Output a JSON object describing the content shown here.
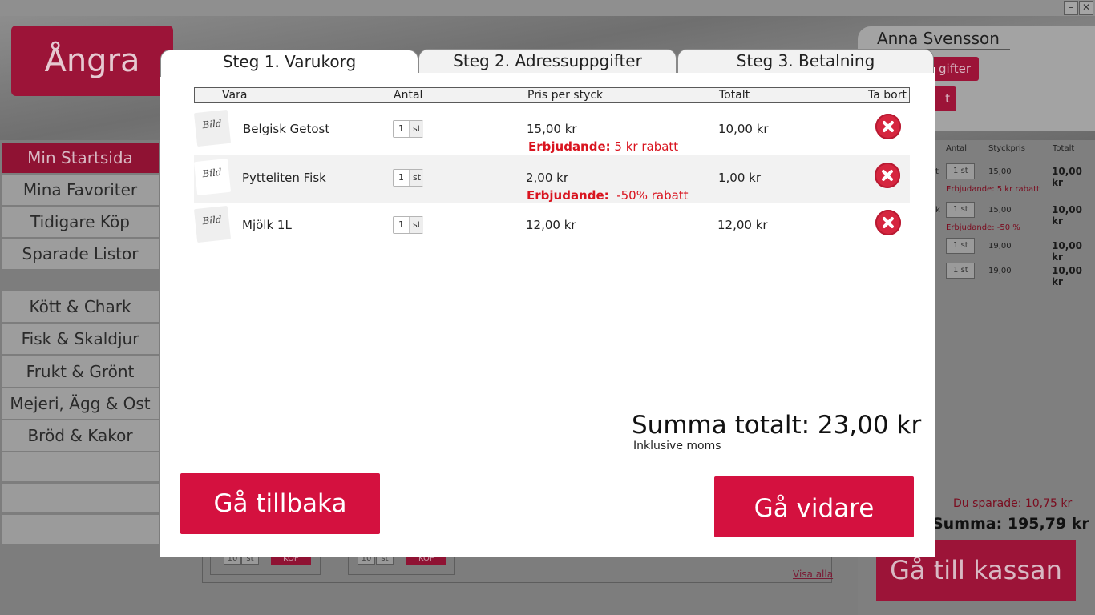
{
  "app": {
    "undo_label": "Ångra",
    "window_controls": {
      "minimize": "–",
      "close": "✕"
    }
  },
  "user": {
    "name": "Anna Svensson",
    "btn1_partial": "gifter",
    "btn2_partial": "t"
  },
  "sidebar": {
    "items": [
      {
        "label": "Min Startsida",
        "active": true
      },
      {
        "label": "Mina Favoriter"
      },
      {
        "label": "Tidigare Köp"
      },
      {
        "label": "Sparade Listor"
      }
    ],
    "categories": [
      {
        "label": "Kött & Chark"
      },
      {
        "label": "Fisk & Skaldjur"
      },
      {
        "label": "Frukt & Grönt"
      },
      {
        "label": "Mejeri, Ägg & Ost"
      },
      {
        "label": "Bröd & Kakor"
      }
    ]
  },
  "background": {
    "card_qty": "10",
    "card_unit": "st",
    "card_buy": "KÖP",
    "visa_alla": "Visa alla"
  },
  "cart_pane": {
    "headers": {
      "antal": "Antal",
      "styckpris": "Styckpris",
      "totalt": "Totalt"
    },
    "rows": [
      {
        "name_partial": "t",
        "qty": "1",
        "unit": "st",
        "price": "15,00",
        "total": "10,00 kr",
        "offer": "Erbjudande: 5 kr rabatt"
      },
      {
        "name_partial": "k",
        "qty": "1",
        "unit": "st",
        "price": "15,00",
        "total": "10,00 kr",
        "offer": "Erbjudande: -50 %"
      },
      {
        "name_partial": "",
        "qty": "1",
        "unit": "st",
        "price": "19,00",
        "total": "10,00 kr",
        "offer": ""
      },
      {
        "name_partial": "",
        "qty": "1",
        "unit": "st",
        "price": "19,00",
        "total": "10,00 kr",
        "offer": ""
      }
    ],
    "saved": "Du sparade: 10,75 kr",
    "sum": "Summa: 195,79 kr",
    "checkout": "Gå till kassan"
  },
  "modal": {
    "tabs": [
      {
        "label": "Steg 1. Varukorg",
        "active": true
      },
      {
        "label": "Steg 2. Adressuppgifter"
      },
      {
        "label": "Steg 3. Betalning"
      }
    ],
    "columns": {
      "vara": "Vara",
      "antal": "Antal",
      "pris": "Pris per styck",
      "totalt": "Totalt",
      "ta_bort": "Ta bort"
    },
    "items": [
      {
        "image_label": "Bild",
        "name": "Belgisk Getost",
        "qty": "1",
        "unit": "st",
        "price": "15,00 kr",
        "total": "10,00 kr",
        "offer_label": "Erbjudande:",
        "offer_value": " 5 kr rabatt"
      },
      {
        "image_label": "Bild",
        "name": "Pytteliten Fisk",
        "qty": "1",
        "unit": "st",
        "price": "2,00 kr",
        "total": "1,00 kr",
        "offer_label": "Erbjudande:",
        "offer_value": "  -50% rabatt"
      },
      {
        "image_label": "Bild",
        "name": "Mjölk 1L",
        "qty": "1",
        "unit": "st",
        "price": "12,00 kr",
        "total": "12,00 kr",
        "offer_label": "",
        "offer_value": ""
      }
    ],
    "summary": {
      "total": "Summa totalt: 23,00 kr",
      "vat_note": "Inklusive moms"
    },
    "buttons": {
      "back": "Gå tillbaka",
      "next": "Gå vidare"
    }
  },
  "colors": {
    "accent": "#d4113f",
    "offer_red": "#d9141f",
    "remove_red": "#d6263f",
    "overlay_gray": "#7d7d7d"
  }
}
